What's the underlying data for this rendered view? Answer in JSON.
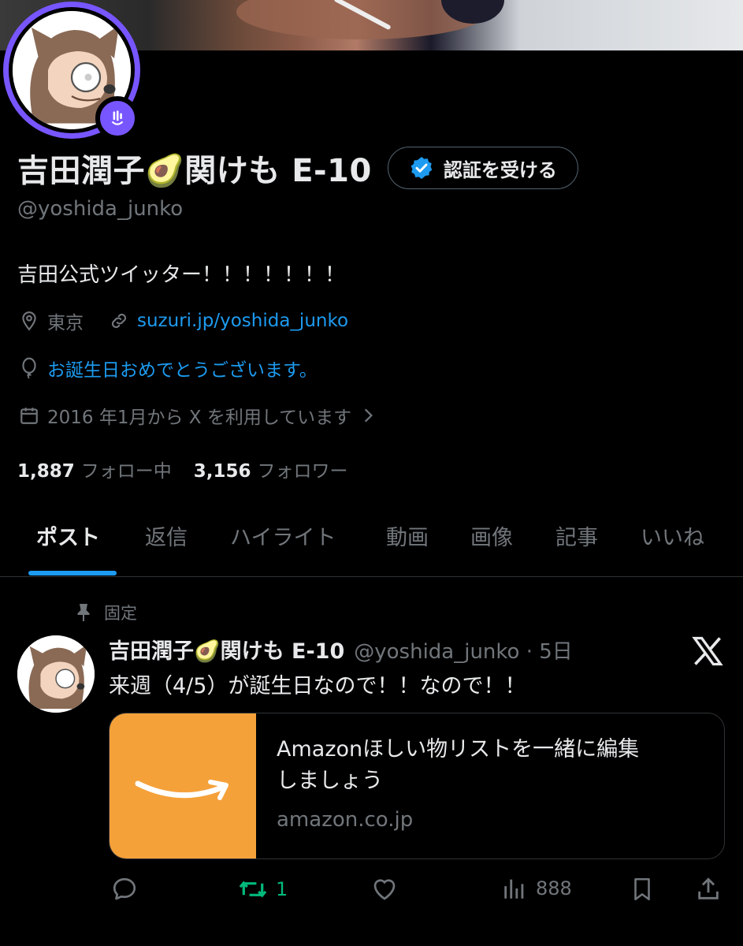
{
  "profile": {
    "display_name": "吉田潤子🥑関けも E-10",
    "handle": "@yoshida_junko",
    "bio": "吉田公式ツイッター！！！！！！！",
    "location": "東京",
    "website": "suzuri.jp/yoshida_junko",
    "birthday_text": "お誕生日おめでとうございます。",
    "joined_text": "2016 年1月から X を利用しています",
    "following_count": "1,887",
    "following_label": "フォロー中",
    "followers_count": "3,156",
    "followers_label": "フォロワー",
    "verify_label": "認証を受ける"
  },
  "tabs": [
    {
      "label": "ポスト",
      "active": true
    },
    {
      "label": "返信"
    },
    {
      "label": "ハイライト"
    },
    {
      "label": "動画"
    },
    {
      "label": "画像"
    },
    {
      "label": "記事"
    },
    {
      "label": "いいね"
    }
  ],
  "post": {
    "pinned_label": "固定",
    "author_name": "吉田潤子🥑関けも E-10",
    "author_handle_time": "@yoshida_junko · 5日",
    "text": "来週（4/5）が誕生日なので！！なので！！",
    "card": {
      "title_line1": "Amazonほしい物リストを一緒に編集",
      "title_line2": "しましょう",
      "domain": "amazon.co.jp"
    },
    "retweet_count": "1",
    "view_count": "888"
  },
  "colors": {
    "accent": "#1d9bf0",
    "spaces_purple": "#7856ff",
    "retweet_green": "#00ba7c",
    "amazon_orange": "#f5a13a"
  }
}
